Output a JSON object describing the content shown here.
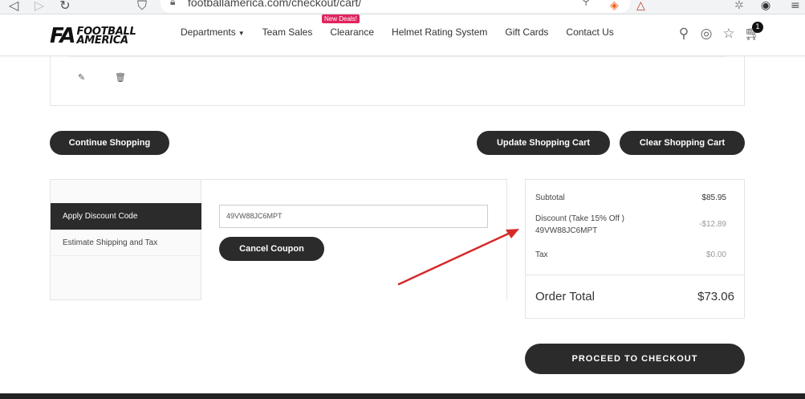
{
  "browser": {
    "url": "footballamerica.com/checkout/cart/",
    "back_icon": "back-arrow-icon",
    "forward_icon": "forward-arrow-icon",
    "reload_icon": "reload-icon",
    "bookmark_icon": "bookmark-icon",
    "lock_icon": "lock-icon"
  },
  "header": {
    "logo_mark": "FA",
    "logo_line1": "FOOTBALL",
    "logo_line2": "AMERICA",
    "badge_label": "New Deals!",
    "nav": [
      {
        "label": "Departments",
        "has_caret": true
      },
      {
        "label": "Team Sales"
      },
      {
        "label": "Clearance"
      },
      {
        "label": "Helmet Rating System"
      },
      {
        "label": "Gift Cards"
      },
      {
        "label": "Contact Us"
      }
    ],
    "cart_count": "1"
  },
  "item_actions": {
    "edit_icon": "pencil-icon",
    "delete_icon": "trash-icon"
  },
  "buttons": {
    "continue_shopping": "Continue Shopping",
    "update_cart": "Update Shopping Cart",
    "clear_cart": "Clear Shopping Cart",
    "cancel_coupon": "Cancel Coupon",
    "checkout": "PROCEED TO CHECKOUT"
  },
  "discount": {
    "tabs": [
      {
        "label": "Apply Discount Code",
        "active": true
      },
      {
        "label": "Estimate Shipping and Tax",
        "active": false
      }
    ],
    "code_value": "49VW88JC6MPT"
  },
  "summary": {
    "subtotal_label": "Subtotal",
    "subtotal_value": "$85.95",
    "discount_label": "Discount (Take 15% Off )",
    "discount_code": "49VW88JC6MPT",
    "discount_value": "-$12.89",
    "tax_label": "Tax",
    "tax_value": "$0.00",
    "order_total_label": "Order Total",
    "order_total_value": "$73.06"
  },
  "colors": {
    "button_dark": "#2b2b2b",
    "badge": "#e0245e",
    "arrow": "#d62a2a"
  }
}
